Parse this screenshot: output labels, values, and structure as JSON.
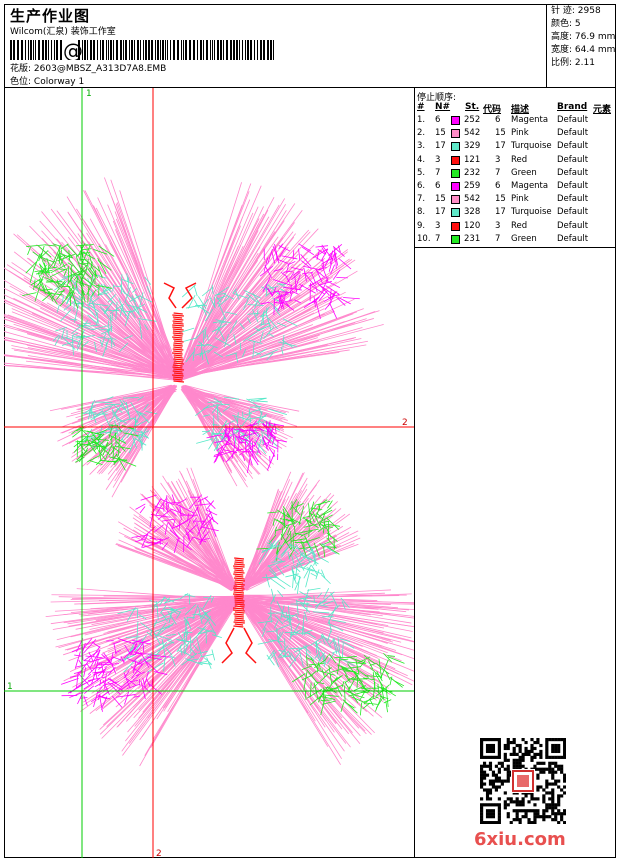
{
  "header": {
    "title": "生产作业图",
    "company": "Wilcom(汇泉) 装饰工作室",
    "barcode_text": "@",
    "design_label": "花版:",
    "design_value": "2603@MBSZ_A313D7A8.EMB",
    "color_label": "色位:",
    "color_value": "Colorway 1"
  },
  "stats": [
    {
      "label": "针 迹:",
      "value": "2958"
    },
    {
      "label": "颜色:",
      "value": "5"
    },
    {
      "label": "高度:",
      "value": "76.9 mm"
    },
    {
      "label": "宽度:",
      "value": "64.4 mm"
    },
    {
      "label": "比例:",
      "value": "2.11"
    }
  ],
  "legend": {
    "title": "停止顺序:",
    "headers": [
      "#",
      "N#",
      "St.",
      "代码",
      "描述",
      "Brand",
      "元素"
    ],
    "rows": [
      {
        "num": "1.",
        "n": "6",
        "st": "252",
        "code": "6",
        "desc": "Magenta",
        "brand": "Default",
        "color": "#ff00ff"
      },
      {
        "num": "2.",
        "n": "15",
        "st": "542",
        "code": "15",
        "desc": "Pink",
        "brand": "Default",
        "color": "#ff8cc6"
      },
      {
        "num": "3.",
        "n": "17",
        "st": "329",
        "code": "17",
        "desc": "Turquoise",
        "brand": "Default",
        "color": "#5fe8c8"
      },
      {
        "num": "4.",
        "n": "3",
        "st": "121",
        "code": "3",
        "desc": "Red",
        "brand": "Default",
        "color": "#ff1010"
      },
      {
        "num": "5.",
        "n": "7",
        "st": "232",
        "code": "7",
        "desc": "Green",
        "brand": "Default",
        "color": "#22e822"
      },
      {
        "num": "6.",
        "n": "6",
        "st": "259",
        "code": "6",
        "desc": "Magenta",
        "brand": "Default",
        "color": "#ff00ff"
      },
      {
        "num": "7.",
        "n": "15",
        "st": "542",
        "code": "15",
        "desc": "Pink",
        "brand": "Default",
        "color": "#ff8cc6"
      },
      {
        "num": "8.",
        "n": "17",
        "st": "328",
        "code": "17",
        "desc": "Turquoise",
        "brand": "Default",
        "color": "#5fe8c8"
      },
      {
        "num": "9.",
        "n": "3",
        "st": "120",
        "code": "3",
        "desc": "Red",
        "brand": "Default",
        "color": "#ff1010"
      },
      {
        "num": "10.",
        "n": "7",
        "st": "231",
        "code": "7",
        "desc": "Green",
        "brand": "Default",
        "color": "#22e822"
      }
    ]
  },
  "guides": {
    "h_label_1": "2",
    "h_label_2": "1",
    "v_label_top": "1",
    "v_label_bottom": "2"
  },
  "footer": {
    "brand": "6xiu.com"
  }
}
